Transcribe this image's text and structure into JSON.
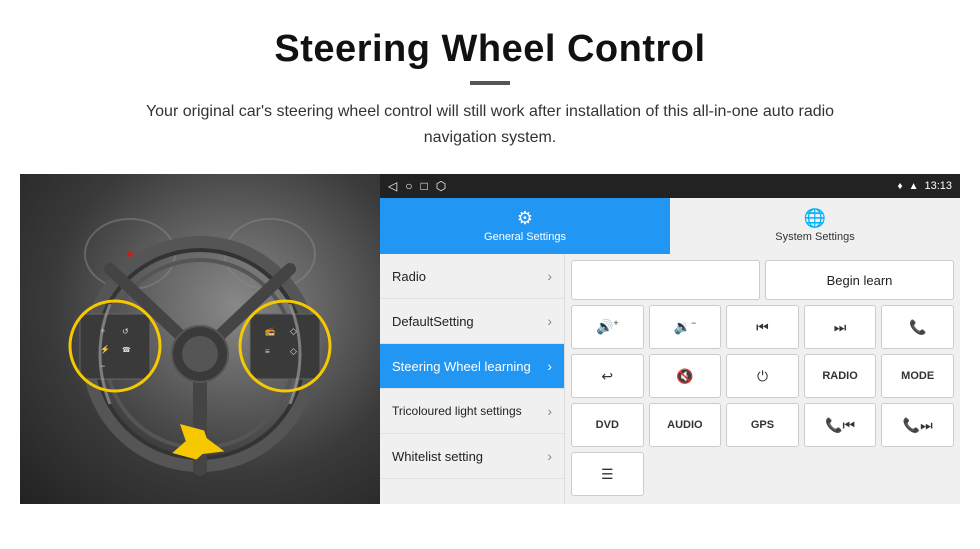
{
  "header": {
    "title": "Steering Wheel Control",
    "divider": true,
    "subtitle": "Your original car's steering wheel control will still work after installation of this all-in-one auto radio navigation system."
  },
  "status_bar": {
    "nav_icons": [
      "◁",
      "○",
      "□",
      "⬡"
    ],
    "right_icons": [
      "♦",
      "▲"
    ],
    "time": "13:13"
  },
  "tabs": [
    {
      "id": "general",
      "label": "General Settings",
      "icon": "⚙",
      "active": true
    },
    {
      "id": "system",
      "label": "System Settings",
      "icon": "🌐",
      "active": false
    }
  ],
  "menu_items": [
    {
      "id": "radio",
      "label": "Radio",
      "active": false
    },
    {
      "id": "default",
      "label": "DefaultSetting",
      "active": false
    },
    {
      "id": "steering",
      "label": "Steering Wheel learning",
      "active": true
    },
    {
      "id": "tricoloured",
      "label": "Tricoloured light settings",
      "active": false
    },
    {
      "id": "whitelist",
      "label": "Whitelist setting",
      "active": false
    }
  ],
  "right_panel": {
    "begin_learn_label": "Begin learn",
    "control_rows": [
      [
        {
          "id": "vol_up",
          "icon": "🔊+",
          "type": "icon"
        },
        {
          "id": "vol_down",
          "icon": "🔉−",
          "type": "icon"
        },
        {
          "id": "prev_track",
          "icon": "⏮",
          "type": "icon"
        },
        {
          "id": "next_track",
          "icon": "⏭",
          "type": "icon"
        },
        {
          "id": "phone",
          "icon": "📞",
          "type": "icon"
        }
      ],
      [
        {
          "id": "hang_up",
          "icon": "↩",
          "type": "icon"
        },
        {
          "id": "mute",
          "icon": "🔇",
          "type": "icon"
        },
        {
          "id": "power",
          "icon": "⏻",
          "type": "icon"
        },
        {
          "id": "radio_btn",
          "label": "RADIO",
          "type": "text"
        },
        {
          "id": "mode_btn",
          "label": "MODE",
          "type": "text"
        }
      ],
      [
        {
          "id": "dvd_btn",
          "label": "DVD",
          "type": "text"
        },
        {
          "id": "audio_btn",
          "label": "AUDIO",
          "type": "text"
        },
        {
          "id": "gps_btn",
          "label": "GPS",
          "type": "text"
        },
        {
          "id": "phone2",
          "icon": "📞⏮",
          "type": "icon"
        },
        {
          "id": "phone3",
          "icon": "📞⏭",
          "type": "icon"
        }
      ],
      [
        {
          "id": "list_icon",
          "icon": "≡",
          "type": "icon"
        }
      ]
    ]
  }
}
